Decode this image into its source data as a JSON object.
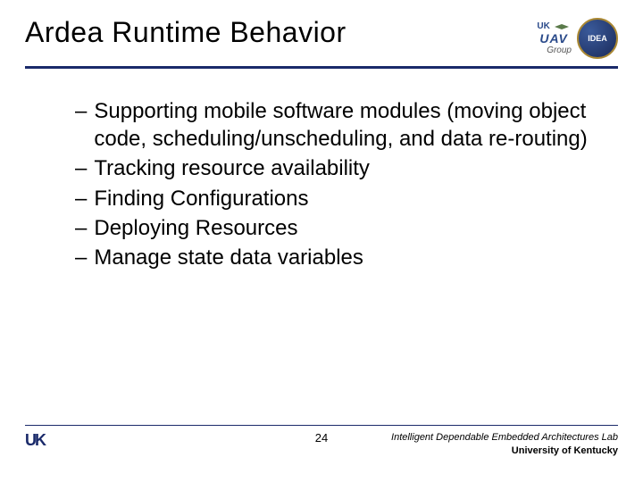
{
  "header": {
    "title": "Ardea Runtime Behavior",
    "logo_uav": {
      "uk": "UK",
      "uav": "UAV",
      "group": "Group"
    },
    "logo_idea": "IDEA"
  },
  "bullets": [
    "Supporting mobile software modules (moving object code, scheduling/unscheduling, and data re-routing)",
    "Tracking resource availability",
    "Finding Configurations",
    "Deploying Resources",
    "Manage state data variables"
  ],
  "footer": {
    "uk": "UK",
    "page": "24",
    "lab": "Intelligent Dependable Embedded Architectures Lab",
    "university": "University of Kentucky"
  }
}
